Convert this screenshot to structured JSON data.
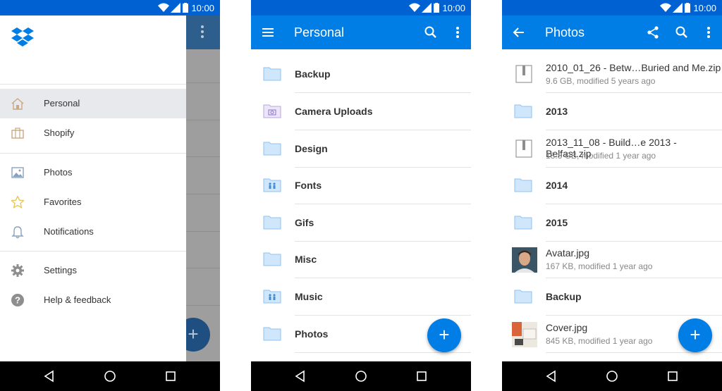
{
  "status": {
    "time": "10:00"
  },
  "drawer": {
    "items": [
      {
        "label": "Personal",
        "icon": "home-icon"
      },
      {
        "label": "Shopify",
        "icon": "briefcase-icon"
      },
      {
        "label": "Photos",
        "icon": "photos-icon"
      },
      {
        "label": "Favorites",
        "icon": "star-icon"
      },
      {
        "label": "Notifications",
        "icon": "bell-icon"
      },
      {
        "label": "Settings",
        "icon": "gear-icon"
      },
      {
        "label": "Help & feedback",
        "icon": "help-icon"
      }
    ]
  },
  "personal": {
    "title": "Personal",
    "items": [
      {
        "label": "Backup",
        "icon": "folder-icon"
      },
      {
        "label": "Camera Uploads",
        "icon": "camera-folder-icon"
      },
      {
        "label": "Design",
        "icon": "folder-icon"
      },
      {
        "label": "Fonts",
        "icon": "shared-folder-icon"
      },
      {
        "label": "Gifs",
        "icon": "folder-icon"
      },
      {
        "label": "Misc",
        "icon": "folder-icon"
      },
      {
        "label": "Music",
        "icon": "shared-folder-icon"
      },
      {
        "label": "Photos",
        "icon": "folder-icon"
      }
    ]
  },
  "photos": {
    "title": "Photos",
    "items": [
      {
        "label": "2010_01_26 - Betw…Buried and Me.zip",
        "meta": "9.6 GB, modified 5 years ago",
        "icon": "zip-icon"
      },
      {
        "label": "2013",
        "icon": "folder-icon"
      },
      {
        "label": "2013_11_08 - Build…e 2013 - Belfast.zip",
        "meta": "18.8 GB, modified 1 year ago",
        "icon": "zip-icon"
      },
      {
        "label": "2014",
        "icon": "folder-icon"
      },
      {
        "label": "2015",
        "icon": "folder-icon"
      },
      {
        "label": "Avatar.jpg",
        "meta": "167 KB, modified 1 year ago",
        "icon": "avatar-thumbnail"
      },
      {
        "label": "Backup",
        "icon": "folder-icon"
      },
      {
        "label": "Cover.jpg",
        "meta": "845 KB, modified 1 year ago",
        "icon": "cover-thumbnail"
      }
    ]
  },
  "colors": {
    "brand": "#007ee5",
    "statusbar": "#0061d3",
    "folder": "#a9d1f5"
  }
}
